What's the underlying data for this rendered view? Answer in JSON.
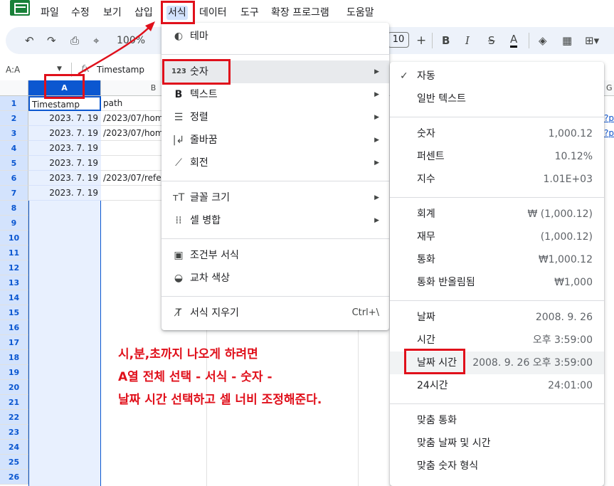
{
  "menubar": {
    "items": [
      "파일",
      "수정",
      "보기",
      "삽입",
      "서식",
      "데이터",
      "도구",
      "확장 프로그램",
      "도움말"
    ]
  },
  "toolbar": {
    "zoom": "100%",
    "font_size": "10",
    "plus": "+",
    "minus": "−",
    "bold": "B",
    "italic": "I",
    "strike": "S",
    "text_color": "A"
  },
  "formula": {
    "name_box": "A:A",
    "fx": "fx",
    "value": "Timestamp"
  },
  "columns": [
    "A",
    "B",
    "G"
  ],
  "rows": [
    "1",
    "2",
    "3",
    "4",
    "5",
    "6",
    "7",
    "8",
    "9",
    "10",
    "11",
    "12",
    "13",
    "14",
    "15",
    "16",
    "17",
    "18",
    "19",
    "20",
    "21",
    "22",
    "23",
    "24",
    "25",
    "26"
  ],
  "cells_a": [
    "Timestamp",
    "2023. 7. 19",
    "2023. 7. 19",
    "2023. 7. 19",
    "2023. 7. 19",
    "2023. 7. 19",
    "2023. 7. 19"
  ],
  "cells_b": [
    "path",
    "/2023/07/hom",
    "/2023/07/hom",
    "",
    "",
    "/2023/07/refer",
    ""
  ],
  "cells_g": [
    "",
    "?p",
    "?p"
  ],
  "format_menu": {
    "theme": "테마",
    "number": "숫자",
    "text": "텍스트",
    "align": "정렬",
    "wrap": "줄바꿈",
    "rotate": "회전",
    "font_size": "글꼴 크기",
    "merge": "셀 병합",
    "conditional": "조건부 서식",
    "alternating": "교차 색상",
    "clear": "서식 지우기",
    "clear_shortcut": "Ctrl+\\",
    "number_icon": "123",
    "text_icon": "B",
    "font_icon": "тT"
  },
  "number_menu": [
    {
      "label": "자동",
      "example": ""
    },
    {
      "label": "일반 텍스트",
      "example": ""
    },
    {
      "label": "숫자",
      "example": "1,000.12"
    },
    {
      "label": "퍼센트",
      "example": "10.12%"
    },
    {
      "label": "지수",
      "example": "1.01E+03"
    },
    {
      "label": "회계",
      "example": "₩ (1,000.12)"
    },
    {
      "label": "재무",
      "example": "(1,000.12)"
    },
    {
      "label": "통화",
      "example": "₩1,000.12"
    },
    {
      "label": "통화 반올림됨",
      "example": "₩1,000"
    },
    {
      "label": "날짜",
      "example": "2008. 9. 26"
    },
    {
      "label": "시간",
      "example": "오후 3:59:00"
    },
    {
      "label": "날짜 시간",
      "example": "2008. 9. 26 오후 3:59:00"
    },
    {
      "label": "24시간",
      "example": "24:01:00"
    },
    {
      "label": "맞춤 통화",
      "example": ""
    },
    {
      "label": "맞춤 날짜 및 시간",
      "example": ""
    },
    {
      "label": "맞춤 숫자 형식",
      "example": ""
    }
  ],
  "annotation": {
    "line1": "시,분,초까지 나오게 하려면",
    "line2": "A열 전체 선택 - 서식 - 숫자 -",
    "line3": "날짜 시간 선택하고 셀 너비 조정해준다."
  },
  "colors": {
    "accent": "#0b57d0",
    "annotation": "#e0101b",
    "sheets_green": "#188038"
  }
}
